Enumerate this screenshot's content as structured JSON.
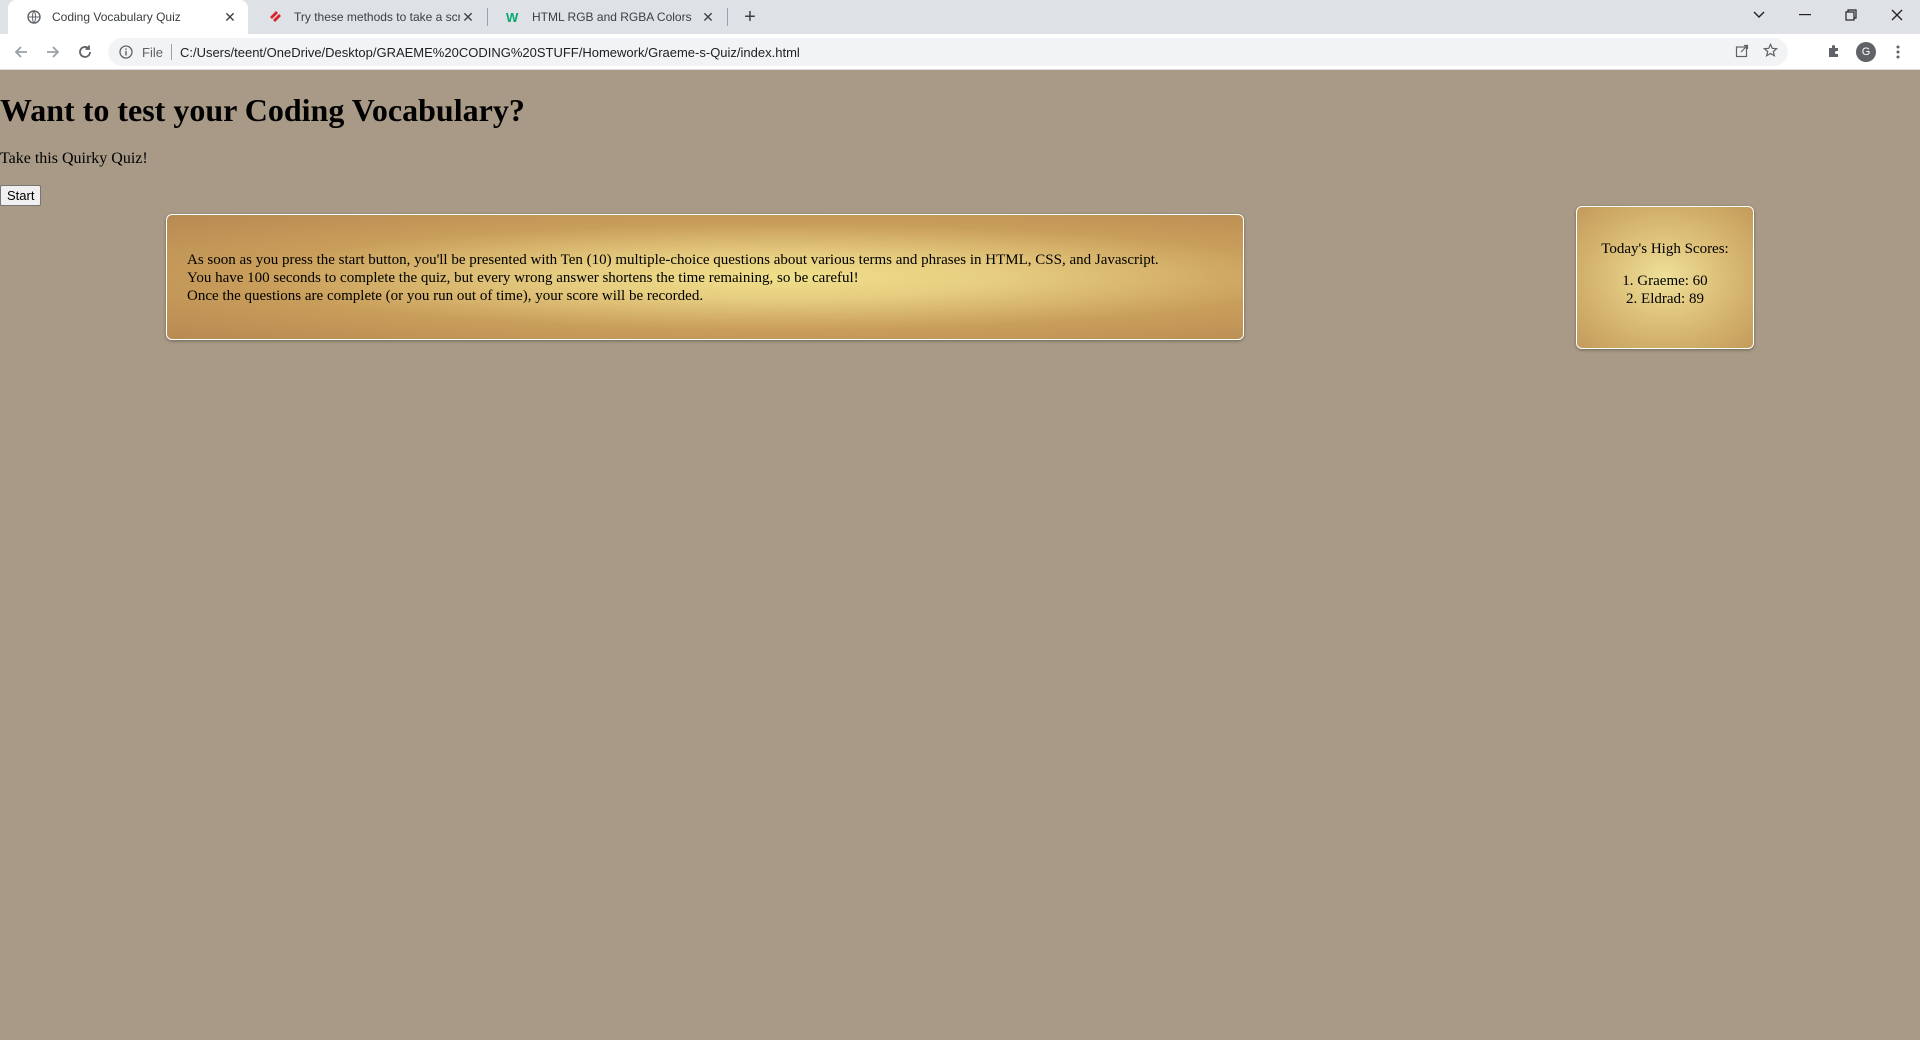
{
  "browser": {
    "tabs": [
      {
        "title": "Coding Vocabulary Quiz",
        "icon": "globe-icon",
        "active": true
      },
      {
        "title": "Try these methods to take a scre",
        "icon": "brand-icon",
        "active": false
      },
      {
        "title": "HTML RGB and RGBA Colors",
        "icon": "w3schools-icon",
        "active": false
      }
    ],
    "new_tab_label": "+",
    "address_bar": {
      "scheme_label": "File",
      "url": "C:/Users/teent/OneDrive/Desktop/GRAEME%20CODING%20STUFF/Homework/Graeme-s-Quiz/index.html"
    },
    "profile_initial": "G"
  },
  "page": {
    "title": "Want to test your Coding Vocabulary?",
    "subtitle": "Take this Quirky Quiz!",
    "start_label": "Start",
    "instructions": [
      "As soon as you press the start button, you'll be presented with Ten (10) multiple-choice questions about various terms and phrases in HTML, CSS, and Javascript.",
      "You have 100 seconds to complete the quiz, but every wrong answer shortens the time remaining, so be careful!",
      "Once the questions are complete (or you run out of time), your score will be recorded."
    ],
    "high_scores": {
      "title": "Today's High Scores:",
      "entries": [
        "Graeme: 60",
        "Eldrad: 89"
      ]
    }
  },
  "colors": {
    "page_background": "#a89a86",
    "card_gold_light": "#f0e08a",
    "card_gold_dark": "#b78a52"
  }
}
